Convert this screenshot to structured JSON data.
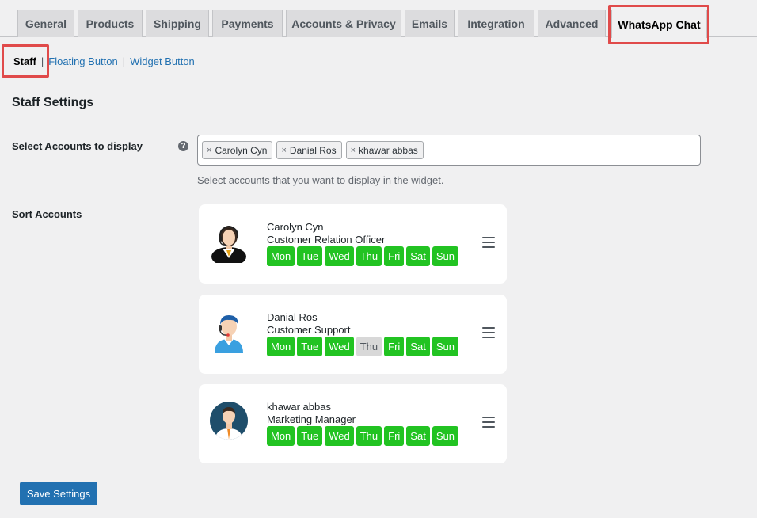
{
  "tabs": [
    {
      "label": "General"
    },
    {
      "label": "Products"
    },
    {
      "label": "Shipping"
    },
    {
      "label": "Payments"
    },
    {
      "label": "Accounts & Privacy"
    },
    {
      "label": "Emails"
    },
    {
      "label": "Integration"
    },
    {
      "label": "Advanced"
    },
    {
      "label": "WhatsApp Chat"
    }
  ],
  "active_tab": "WhatsApp Chat",
  "subnav": {
    "current": "Staff",
    "separator": "|",
    "links": [
      "Floating Button",
      "Widget Button"
    ]
  },
  "section_title": "Staff Settings",
  "accounts_field": {
    "label": "Select Accounts to display",
    "help": "?",
    "selected": [
      "Carolyn Cyn",
      "Danial Ros",
      "khawar abbas"
    ],
    "remove_glyph": "×",
    "description": "Select accounts that you want to display in the widget."
  },
  "sort_label": "Sort Accounts",
  "staff": [
    {
      "name": "Carolyn Cyn",
      "role": "Customer Relation Officer",
      "days": [
        {
          "label": "Mon",
          "active": true
        },
        {
          "label": "Tue",
          "active": true
        },
        {
          "label": "Wed",
          "active": true
        },
        {
          "label": "Thu",
          "active": true
        },
        {
          "label": "Fri",
          "active": true
        },
        {
          "label": "Sat",
          "active": true
        },
        {
          "label": "Sun",
          "active": true
        }
      ]
    },
    {
      "name": "Danial Ros",
      "role": "Customer Support",
      "days": [
        {
          "label": "Mon",
          "active": true
        },
        {
          "label": "Tue",
          "active": true
        },
        {
          "label": "Wed",
          "active": true
        },
        {
          "label": "Thu",
          "active": false
        },
        {
          "label": "Fri",
          "active": true
        },
        {
          "label": "Sat",
          "active": true
        },
        {
          "label": "Sun",
          "active": true
        }
      ]
    },
    {
      "name": "khawar abbas",
      "role": "Marketing Manager",
      "days": [
        {
          "label": "Mon",
          "active": true
        },
        {
          "label": "Tue",
          "active": true
        },
        {
          "label": "Wed",
          "active": true
        },
        {
          "label": "Thu",
          "active": true
        },
        {
          "label": "Fri",
          "active": true
        },
        {
          "label": "Sat",
          "active": true
        },
        {
          "label": "Sun",
          "active": true
        }
      ]
    }
  ],
  "save_label": "Save Settings",
  "colors": {
    "day_active": "#22c322",
    "day_inactive": "#d8d8d8",
    "primary_button": "#2271b1",
    "highlight": "#e04a4a"
  }
}
